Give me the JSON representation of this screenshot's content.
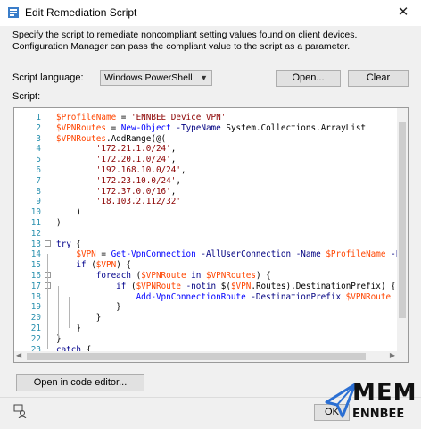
{
  "window": {
    "title": "Edit Remediation Script",
    "close_glyph": "✕"
  },
  "description": "Specify the script to remediate noncompliant setting values found on client devices. Configuration Manager can pass the compliant value to the script as a parameter.",
  "script_language": {
    "label": "Script language:",
    "value": "Windows PowerShell"
  },
  "buttons": {
    "open": "Open...",
    "clear": "Clear",
    "open_in_editor": "Open in code editor...",
    "ok": "OK"
  },
  "script_label": "Script:",
  "colors": {
    "variable": "#ff4500",
    "string": "#8b0000",
    "keyword": "#00008b",
    "command": "#0000ff",
    "parameter": "#000080",
    "type": "#008080",
    "line_number": "#2b91af",
    "brand": "#2b6fd3"
  },
  "code": {
    "lines": [
      [
        {
          "t": "$ProfileName",
          "k": "v"
        },
        {
          "t": " = ",
          "k": "p"
        },
        {
          "t": "'ENNBEE Device VPN'",
          "k": "s"
        }
      ],
      [
        {
          "t": "$VPNRoutes",
          "k": "v"
        },
        {
          "t": " = ",
          "k": "p"
        },
        {
          "t": "New-Object",
          "k": "c"
        },
        {
          "t": " ",
          "k": "p"
        },
        {
          "t": "-TypeName",
          "k": "a"
        },
        {
          "t": " System.Collections.ArrayList",
          "k": "p"
        }
      ],
      [
        {
          "t": "$VPNRoutes",
          "k": "v"
        },
        {
          "t": ".AddRange(@(",
          "k": "p"
        }
      ],
      [
        {
          "t": "        ",
          "k": "p"
        },
        {
          "t": "'172.21.1.0/24'",
          "k": "s"
        },
        {
          "t": ",",
          "k": "p"
        }
      ],
      [
        {
          "t": "        ",
          "k": "p"
        },
        {
          "t": "'172.20.1.0/24'",
          "k": "s"
        },
        {
          "t": ",",
          "k": "p"
        }
      ],
      [
        {
          "t": "        ",
          "k": "p"
        },
        {
          "t": "'192.168.10.0/24'",
          "k": "s"
        },
        {
          "t": ",",
          "k": "p"
        }
      ],
      [
        {
          "t": "        ",
          "k": "p"
        },
        {
          "t": "'172.23.10.0/24'",
          "k": "s"
        },
        {
          "t": ",",
          "k": "p"
        }
      ],
      [
        {
          "t": "        ",
          "k": "p"
        },
        {
          "t": "'172.37.0.0/16'",
          "k": "s"
        },
        {
          "t": ",",
          "k": "p"
        }
      ],
      [
        {
          "t": "        ",
          "k": "p"
        },
        {
          "t": "'18.103.2.112/32'",
          "k": "s"
        }
      ],
      [
        {
          "t": "    )",
          "k": "p"
        }
      ],
      [
        {
          "t": ")",
          "k": "p"
        }
      ],
      [],
      [
        {
          "t": "try",
          "k": "k"
        },
        {
          "t": " {",
          "k": "p"
        }
      ],
      [
        {
          "t": "    ",
          "k": "p"
        },
        {
          "t": "$VPN",
          "k": "v"
        },
        {
          "t": " = ",
          "k": "p"
        },
        {
          "t": "Get-VpnConnection",
          "k": "c"
        },
        {
          "t": " ",
          "k": "p"
        },
        {
          "t": "-AllUserConnection",
          "k": "a"
        },
        {
          "t": " ",
          "k": "p"
        },
        {
          "t": "-Name",
          "k": "a"
        },
        {
          "t": " ",
          "k": "p"
        },
        {
          "t": "$ProfileName",
          "k": "v"
        },
        {
          "t": " ",
          "k": "p"
        },
        {
          "t": "-E",
          "k": "a"
        }
      ],
      [
        {
          "t": "    ",
          "k": "p"
        },
        {
          "t": "if",
          "k": "k"
        },
        {
          "t": " (",
          "k": "p"
        },
        {
          "t": "$VPN",
          "k": "v"
        },
        {
          "t": ") {",
          "k": "p"
        }
      ],
      [
        {
          "t": "        ",
          "k": "p"
        },
        {
          "t": "foreach",
          "k": "k"
        },
        {
          "t": " (",
          "k": "p"
        },
        {
          "t": "$VPNRoute",
          "k": "v"
        },
        {
          "t": " ",
          "k": "p"
        },
        {
          "t": "in",
          "k": "k"
        },
        {
          "t": " ",
          "k": "p"
        },
        {
          "t": "$VPNRoutes",
          "k": "v"
        },
        {
          "t": ") {",
          "k": "p"
        }
      ],
      [
        {
          "t": "            ",
          "k": "p"
        },
        {
          "t": "if",
          "k": "k"
        },
        {
          "t": " (",
          "k": "p"
        },
        {
          "t": "$VPNRoute",
          "k": "v"
        },
        {
          "t": " ",
          "k": "p"
        },
        {
          "t": "-notin",
          "k": "a"
        },
        {
          "t": " $(",
          "k": "p"
        },
        {
          "t": "$VPN",
          "k": "v"
        },
        {
          "t": ".Routes).DestinationPrefix) {",
          "k": "p"
        }
      ],
      [
        {
          "t": "                ",
          "k": "p"
        },
        {
          "t": "Add-VpnConnectionRoute",
          "k": "c"
        },
        {
          "t": " ",
          "k": "p"
        },
        {
          "t": "-DestinationPrefix",
          "k": "a"
        },
        {
          "t": " ",
          "k": "p"
        },
        {
          "t": "$VPNRoute",
          "k": "v"
        },
        {
          "t": " -",
          "k": "p"
        }
      ],
      [
        {
          "t": "            }",
          "k": "p"
        }
      ],
      [
        {
          "t": "        }",
          "k": "p"
        }
      ],
      [
        {
          "t": "    }",
          "k": "p"
        }
      ],
      [
        {
          "t": "}",
          "k": "p"
        }
      ],
      [
        {
          "t": "catch",
          "k": "k"
        },
        {
          "t": " {",
          "k": "p"
        }
      ]
    ]
  },
  "brand": {
    "top": "MEM",
    "bottom": "ENNBEE"
  }
}
